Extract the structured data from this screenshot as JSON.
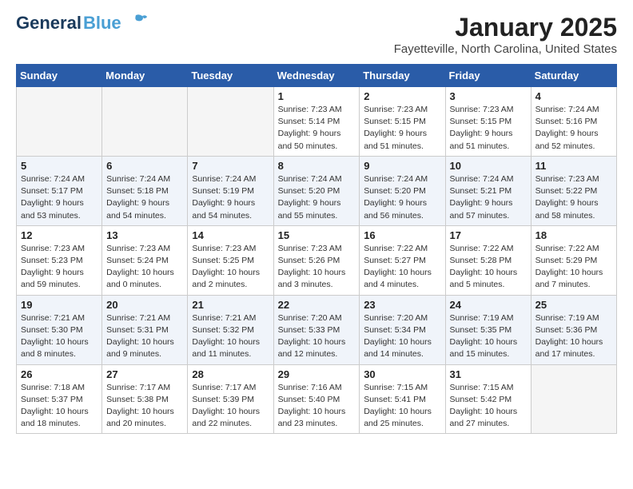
{
  "header": {
    "logo_general": "General",
    "logo_blue": "Blue",
    "title": "January 2025",
    "subtitle": "Fayetteville, North Carolina, United States"
  },
  "weekdays": [
    "Sunday",
    "Monday",
    "Tuesday",
    "Wednesday",
    "Thursday",
    "Friday",
    "Saturday"
  ],
  "weeks": [
    [
      {
        "day": "",
        "info": ""
      },
      {
        "day": "",
        "info": ""
      },
      {
        "day": "",
        "info": ""
      },
      {
        "day": "1",
        "info": "Sunrise: 7:23 AM\nSunset: 5:14 PM\nDaylight: 9 hours\nand 50 minutes."
      },
      {
        "day": "2",
        "info": "Sunrise: 7:23 AM\nSunset: 5:15 PM\nDaylight: 9 hours\nand 51 minutes."
      },
      {
        "day": "3",
        "info": "Sunrise: 7:23 AM\nSunset: 5:15 PM\nDaylight: 9 hours\nand 51 minutes."
      },
      {
        "day": "4",
        "info": "Sunrise: 7:24 AM\nSunset: 5:16 PM\nDaylight: 9 hours\nand 52 minutes."
      }
    ],
    [
      {
        "day": "5",
        "info": "Sunrise: 7:24 AM\nSunset: 5:17 PM\nDaylight: 9 hours\nand 53 minutes."
      },
      {
        "day": "6",
        "info": "Sunrise: 7:24 AM\nSunset: 5:18 PM\nDaylight: 9 hours\nand 54 minutes."
      },
      {
        "day": "7",
        "info": "Sunrise: 7:24 AM\nSunset: 5:19 PM\nDaylight: 9 hours\nand 54 minutes."
      },
      {
        "day": "8",
        "info": "Sunrise: 7:24 AM\nSunset: 5:20 PM\nDaylight: 9 hours\nand 55 minutes."
      },
      {
        "day": "9",
        "info": "Sunrise: 7:24 AM\nSunset: 5:20 PM\nDaylight: 9 hours\nand 56 minutes."
      },
      {
        "day": "10",
        "info": "Sunrise: 7:24 AM\nSunset: 5:21 PM\nDaylight: 9 hours\nand 57 minutes."
      },
      {
        "day": "11",
        "info": "Sunrise: 7:23 AM\nSunset: 5:22 PM\nDaylight: 9 hours\nand 58 minutes."
      }
    ],
    [
      {
        "day": "12",
        "info": "Sunrise: 7:23 AM\nSunset: 5:23 PM\nDaylight: 9 hours\nand 59 minutes."
      },
      {
        "day": "13",
        "info": "Sunrise: 7:23 AM\nSunset: 5:24 PM\nDaylight: 10 hours\nand 0 minutes."
      },
      {
        "day": "14",
        "info": "Sunrise: 7:23 AM\nSunset: 5:25 PM\nDaylight: 10 hours\nand 2 minutes."
      },
      {
        "day": "15",
        "info": "Sunrise: 7:23 AM\nSunset: 5:26 PM\nDaylight: 10 hours\nand 3 minutes."
      },
      {
        "day": "16",
        "info": "Sunrise: 7:22 AM\nSunset: 5:27 PM\nDaylight: 10 hours\nand 4 minutes."
      },
      {
        "day": "17",
        "info": "Sunrise: 7:22 AM\nSunset: 5:28 PM\nDaylight: 10 hours\nand 5 minutes."
      },
      {
        "day": "18",
        "info": "Sunrise: 7:22 AM\nSunset: 5:29 PM\nDaylight: 10 hours\nand 7 minutes."
      }
    ],
    [
      {
        "day": "19",
        "info": "Sunrise: 7:21 AM\nSunset: 5:30 PM\nDaylight: 10 hours\nand 8 minutes."
      },
      {
        "day": "20",
        "info": "Sunrise: 7:21 AM\nSunset: 5:31 PM\nDaylight: 10 hours\nand 9 minutes."
      },
      {
        "day": "21",
        "info": "Sunrise: 7:21 AM\nSunset: 5:32 PM\nDaylight: 10 hours\nand 11 minutes."
      },
      {
        "day": "22",
        "info": "Sunrise: 7:20 AM\nSunset: 5:33 PM\nDaylight: 10 hours\nand 12 minutes."
      },
      {
        "day": "23",
        "info": "Sunrise: 7:20 AM\nSunset: 5:34 PM\nDaylight: 10 hours\nand 14 minutes."
      },
      {
        "day": "24",
        "info": "Sunrise: 7:19 AM\nSunset: 5:35 PM\nDaylight: 10 hours\nand 15 minutes."
      },
      {
        "day": "25",
        "info": "Sunrise: 7:19 AM\nSunset: 5:36 PM\nDaylight: 10 hours\nand 17 minutes."
      }
    ],
    [
      {
        "day": "26",
        "info": "Sunrise: 7:18 AM\nSunset: 5:37 PM\nDaylight: 10 hours\nand 18 minutes."
      },
      {
        "day": "27",
        "info": "Sunrise: 7:17 AM\nSunset: 5:38 PM\nDaylight: 10 hours\nand 20 minutes."
      },
      {
        "day": "28",
        "info": "Sunrise: 7:17 AM\nSunset: 5:39 PM\nDaylight: 10 hours\nand 22 minutes."
      },
      {
        "day": "29",
        "info": "Sunrise: 7:16 AM\nSunset: 5:40 PM\nDaylight: 10 hours\nand 23 minutes."
      },
      {
        "day": "30",
        "info": "Sunrise: 7:15 AM\nSunset: 5:41 PM\nDaylight: 10 hours\nand 25 minutes."
      },
      {
        "day": "31",
        "info": "Sunrise: 7:15 AM\nSunset: 5:42 PM\nDaylight: 10 hours\nand 27 minutes."
      },
      {
        "day": "",
        "info": ""
      }
    ]
  ]
}
